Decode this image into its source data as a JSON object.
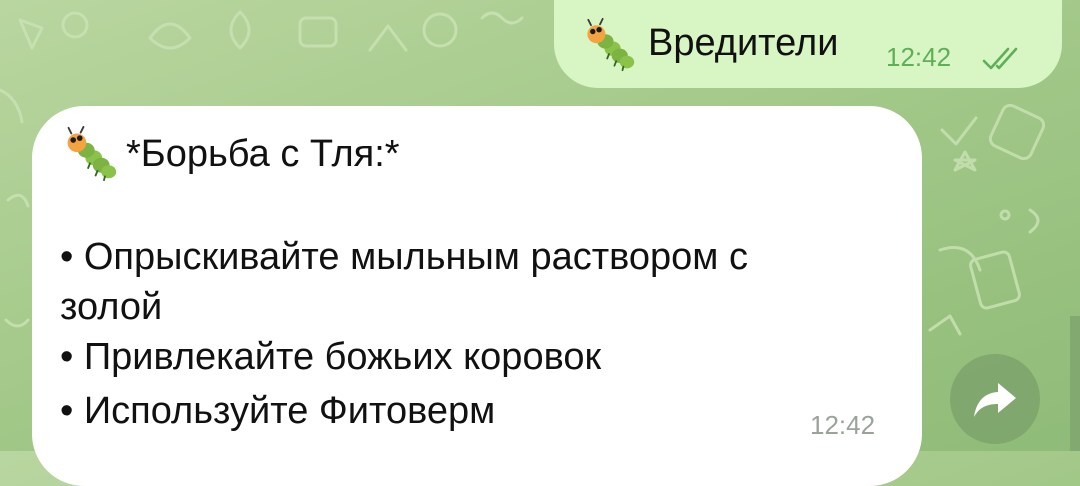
{
  "chat": {
    "outgoing_message": {
      "emoji_icon": "caterpillar-emoji",
      "text": "Вредители",
      "time": "12:42",
      "status_icon": "double-check-read-icon"
    },
    "incoming_message": {
      "emoji_icon": "caterpillar-emoji",
      "title": "*Борьба с Тля:*",
      "lines": [
        "• Опрыскивайте мыльным раствором с",
        "золой",
        "• Привлекайте божьих коровок",
        "• Используйте Фитоверм"
      ],
      "time": "12:42"
    },
    "share_button": {
      "icon": "share-forward-icon"
    }
  },
  "colors": {
    "wallpaper": "#a4c98a",
    "outgoing_bubble": "#d8f6c4",
    "incoming_bubble": "#ffffff",
    "outgoing_time": "#5fae5a",
    "incoming_time": "#9aa39a"
  }
}
